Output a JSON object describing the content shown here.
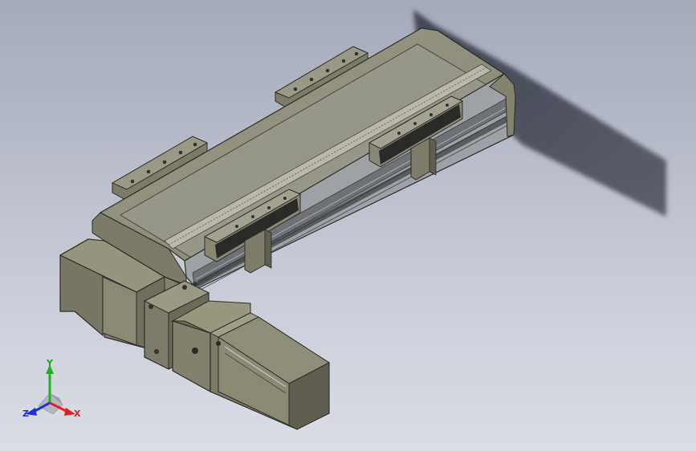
{
  "viewport": {
    "background_top": "#a4a9ba",
    "background_bottom": "#dcdee6"
  },
  "model": {
    "body_color": "#8f8e7a",
    "body_dark": "#6c6b5c",
    "rail_color": "#9fa2a6",
    "rail_dark": "#5c5f63",
    "shadow_color": "#4e5260"
  },
  "triad": {
    "x_label": "X",
    "y_label": "Y",
    "z_label": "Z",
    "x_color": "#e02020",
    "y_color": "#20b020",
    "z_color": "#2030e0",
    "icon": "coordinate-triad-icon"
  }
}
